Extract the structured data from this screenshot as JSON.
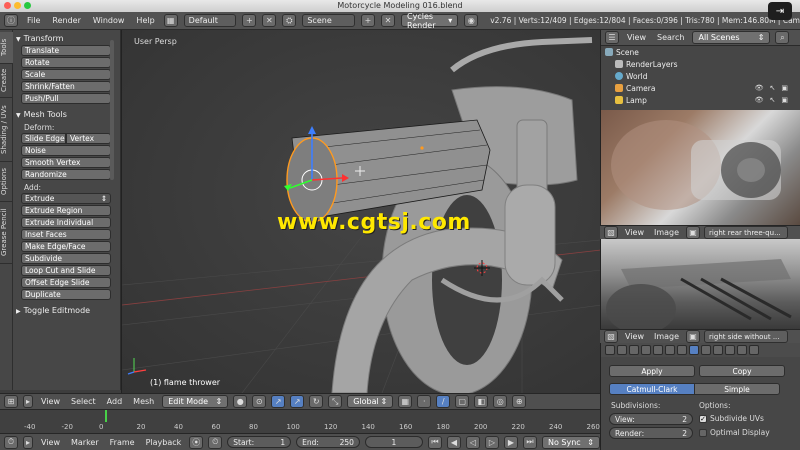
{
  "window": {
    "title": "Motorcycle Modeling 016.blend"
  },
  "topbar": {
    "menus": [
      "File",
      "Render",
      "Window",
      "Help"
    ],
    "layout": "Default",
    "scene": "Scene",
    "engine": "Cycles Render",
    "stats": "v2.76 | Verts:12/409 | Edges:12/804 | Faces:0/396 | Tris:780 | Mem:146.80M | Cam"
  },
  "tool_tabs": [
    "Tools",
    "Create",
    "Shading / UVs",
    "Options",
    "Grease Pencil"
  ],
  "toolshelf": {
    "transform": {
      "title": "Transform",
      "buttons": [
        "Translate",
        "Rotate",
        "Scale",
        "Shrink/Fatten",
        "Push/Pull"
      ]
    },
    "mesh_tools": {
      "title": "Mesh Tools",
      "deform_label": "Deform:",
      "deform_row": [
        "Slide Edge",
        "Vertex"
      ],
      "deform_buttons": [
        "Noise",
        "Smooth Vertex",
        "Randomize"
      ],
      "add_label": "Add:",
      "extrude": "Extrude",
      "add_buttons": [
        "Extrude Region",
        "Extrude Individual",
        "Inset Faces",
        "Make Edge/Face",
        "Subdivide",
        "Loop Cut and Slide",
        "Offset Edge Slide",
        "Duplicate"
      ]
    },
    "toggle": "Toggle Editmode"
  },
  "viewport": {
    "label": "User Persp",
    "object_label": "(1) flame thrower",
    "watermark": "www.cgtsj.com"
  },
  "viewport_header": {
    "menus": [
      "View",
      "Select",
      "Add",
      "Mesh"
    ],
    "mode": "Edit Mode",
    "orientation": "Global"
  },
  "timeline": {
    "ticks": [
      "-40",
      "-20",
      "0",
      "20",
      "40",
      "60",
      "80",
      "100",
      "120",
      "140",
      "160",
      "180",
      "200",
      "220",
      "240",
      "260"
    ],
    "current_frame": 0
  },
  "bottombar": {
    "menus": [
      "View",
      "Marker",
      "Frame",
      "Playback"
    ],
    "start_label": "Start:",
    "start_value": "1",
    "end_label": "End:",
    "end_value": "250",
    "frame_value": "1",
    "sync": "No Sync"
  },
  "outliner": {
    "view": "View",
    "search": "Search",
    "filter": "All Scenes",
    "items": [
      "Scene",
      "RenderLayers",
      "World",
      "Camera",
      "Lamp"
    ]
  },
  "image_editor_1": {
    "view": "View",
    "image": "Image",
    "name": "right rear three-qu..."
  },
  "image_editor_2": {
    "view": "View",
    "image": "Image",
    "name": "right side without ..."
  },
  "properties": {
    "apply": "Apply",
    "copy": "Copy",
    "catmull": "Catmull-Clark",
    "simple": "Simple",
    "subdivisions_label": "Subdivisions:",
    "view_label": "View:",
    "view_value": "2",
    "render_label": "Render:",
    "render_value": "2",
    "options_label": "Options:",
    "subdivide_uvs": "Subdivide UVs",
    "optimal_display": "Optimal Display"
  },
  "colors": {
    "accent": "#5680c2",
    "timeline_cursor": "#48d148",
    "watermark": "#ffe800"
  }
}
